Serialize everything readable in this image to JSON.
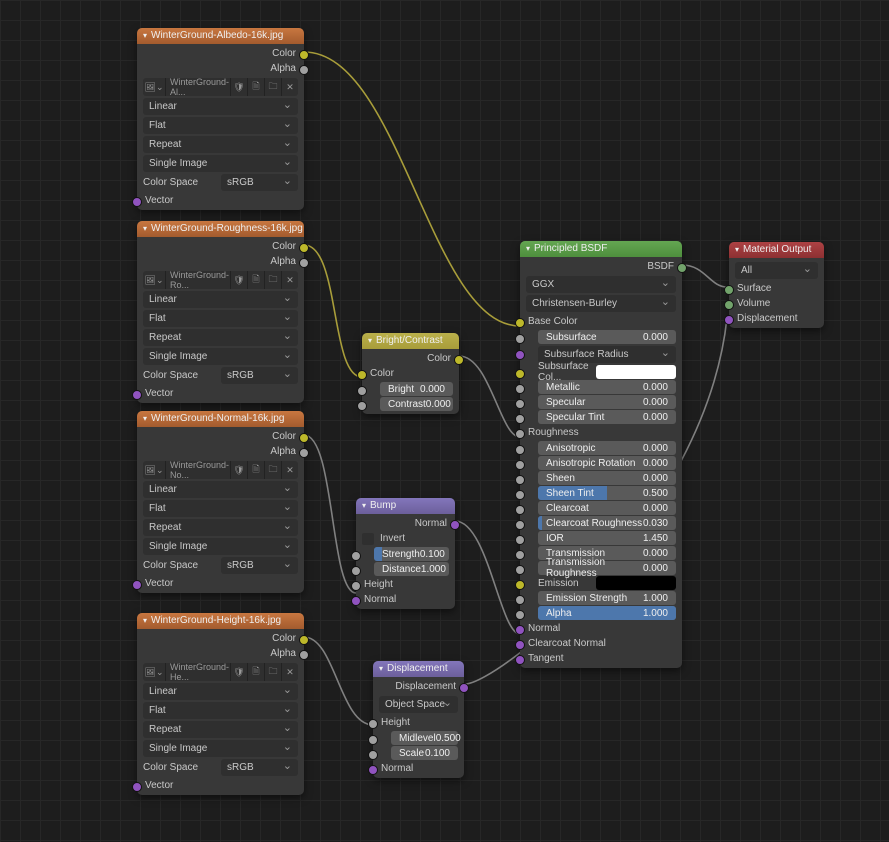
{
  "nodes": {
    "albedo": {
      "title": "WinterGround-Albedo-16k.jpg",
      "outputs": {
        "color": "Color",
        "alpha": "Alpha"
      },
      "file": "WinterGround-Al...",
      "interpolation": "Linear",
      "projection": "Flat",
      "extension": "Repeat",
      "source": "Single Image",
      "color_space_label": "Color Space",
      "color_space_value": "sRGB",
      "vector_in": "Vector"
    },
    "roughness": {
      "title": "WinterGround-Roughness-16k.jpg",
      "outputs": {
        "color": "Color",
        "alpha": "Alpha"
      },
      "file": "WinterGround-Ro...",
      "interpolation": "Linear",
      "projection": "Flat",
      "extension": "Repeat",
      "source": "Single Image",
      "color_space_label": "Color Space",
      "color_space_value": "sRGB",
      "vector_in": "Vector"
    },
    "normal": {
      "title": "WinterGround-Normal-16k.jpg",
      "outputs": {
        "color": "Color",
        "alpha": "Alpha"
      },
      "file": "WinterGround-No...",
      "interpolation": "Linear",
      "projection": "Flat",
      "extension": "Repeat",
      "source": "Single Image",
      "color_space_label": "Color Space",
      "color_space_value": "sRGB",
      "vector_in": "Vector"
    },
    "height": {
      "title": "WinterGround-Height-16k.jpg",
      "outputs": {
        "color": "Color",
        "alpha": "Alpha"
      },
      "file": "WinterGround-He...",
      "interpolation": "Linear",
      "projection": "Flat",
      "extension": "Repeat",
      "source": "Single Image",
      "color_space_label": "Color Space",
      "color_space_value": "sRGB",
      "vector_in": "Vector"
    },
    "brightcontrast": {
      "title": "Bright/Contrast",
      "out_color": "Color",
      "in_color": "Color",
      "bright_label": "Bright",
      "bright_val": "0.000",
      "contrast_label": "Contrast",
      "contrast_val": "0.000"
    },
    "bump": {
      "title": "Bump",
      "out_normal": "Normal",
      "invert": "Invert",
      "strength_label": "Strength",
      "strength_val": "0.100",
      "distance_label": "Distance",
      "distance_val": "1.000",
      "in_height": "Height",
      "in_normal": "Normal"
    },
    "displacement": {
      "title": "Displacement",
      "out_disp": "Displacement",
      "space": "Object Space",
      "in_height": "Height",
      "midlevel_label": "Midlevel",
      "midlevel_val": "0.500",
      "scale_label": "Scale",
      "scale_val": "0.100",
      "in_normal": "Normal"
    },
    "bsdf": {
      "title": "Principled BSDF",
      "out_bsdf": "BSDF",
      "distribution": "GGX",
      "sss_method": "Christensen-Burley",
      "base_color": "Base Color",
      "subsurface_label": "Subsurface",
      "subsurface_val": "0.000",
      "subsurface_radius": "Subsurface Radius",
      "subsurface_color": "Subsurface Col...",
      "subsurface_swatch": "#ffffff",
      "metallic_label": "Metallic",
      "metallic_val": "0.000",
      "specular_label": "Specular",
      "specular_val": "0.000",
      "spectint_label": "Specular Tint",
      "spectint_val": "0.000",
      "roughness_in": "Roughness",
      "aniso_label": "Anisotropic",
      "aniso_val": "0.000",
      "anisor_label": "Anisotropic Rotation",
      "anisor_val": "0.000",
      "sheen_label": "Sheen",
      "sheen_val": "0.000",
      "sheentint_label": "Sheen Tint",
      "sheentint_val": "0.500",
      "clearcoat_label": "Clearcoat",
      "clearcoat_val": "0.000",
      "clearcoatr_label": "Clearcoat Roughness",
      "clearcoatr_val": "0.030",
      "ior_label": "IOR",
      "ior_val": "1.450",
      "trans_label": "Transmission",
      "trans_val": "0.000",
      "transr_label": "Transmission Roughness",
      "transr_val": "0.000",
      "emission_label": "Emission",
      "emission_swatch": "#000000",
      "emissionstr_label": "Emission Strength",
      "emissionstr_val": "1.000",
      "alpha_label": "Alpha",
      "alpha_val": "1.000",
      "normal_in": "Normal",
      "clearcoat_normal_in": "Clearcoat Normal",
      "tangent_in": "Tangent"
    },
    "matout": {
      "title": "Material Output",
      "target": "All",
      "surface": "Surface",
      "volume": "Volume",
      "displacement": "Displacement"
    }
  },
  "icons": {
    "picker": "▾",
    "newimg": "▦",
    "open": "📁",
    "n": "2",
    "unlink": "✕"
  }
}
